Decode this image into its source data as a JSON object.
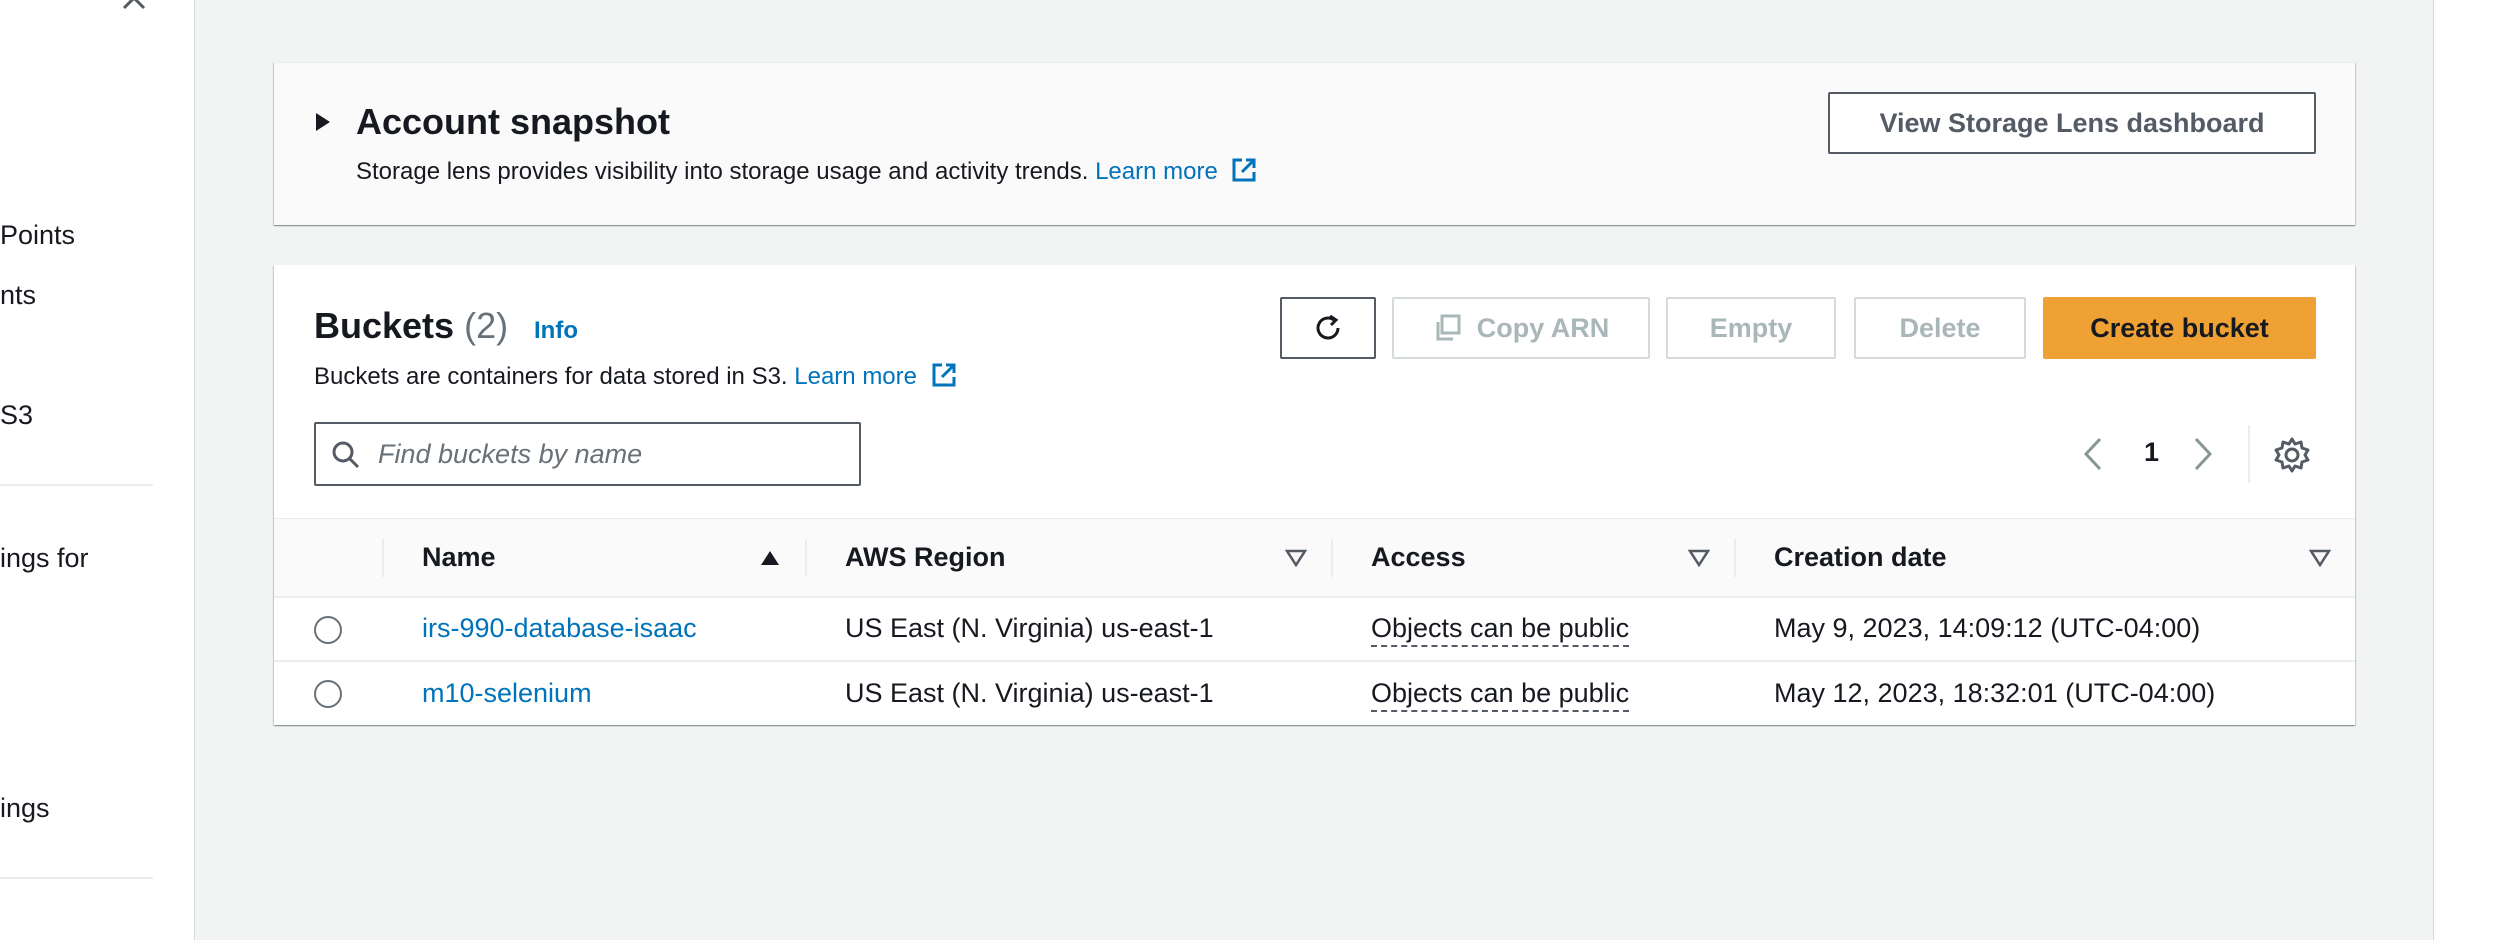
{
  "sidebar": {
    "items": [
      "Points",
      "nts",
      "S3",
      "ings for",
      "ings"
    ]
  },
  "snapshot": {
    "title": "Account snapshot",
    "description": "Storage lens provides visibility into storage usage and activity trends.",
    "learn_more": "Learn more",
    "dashboard_button": "View Storage Lens dashboard"
  },
  "buckets": {
    "title": "Buckets",
    "count": "(2)",
    "info": "Info",
    "description": "Buckets are containers for data stored in S3.",
    "learn_more": "Learn more",
    "toolbar": {
      "copy_arn": "Copy ARN",
      "empty": "Empty",
      "delete": "Delete",
      "create": "Create bucket"
    },
    "search_placeholder": "Find buckets by name",
    "page": "1",
    "columns": [
      "Name",
      "AWS Region",
      "Access",
      "Creation date"
    ],
    "rows": [
      {
        "name": "irs-990-database-isaac",
        "region": "US East (N. Virginia) us-east-1",
        "access": "Objects can be public",
        "created": "May 9, 2023, 14:09:12 (UTC-04:00)"
      },
      {
        "name": "m10-selenium",
        "region": "US East (N. Virginia) us-east-1",
        "access": "Objects can be public",
        "created": "May 12, 2023, 18:32:01 (UTC-04:00)"
      }
    ]
  },
  "colors": {
    "link": "#0073bb",
    "primary": "#f0a133",
    "background": "#f2f3f3"
  }
}
